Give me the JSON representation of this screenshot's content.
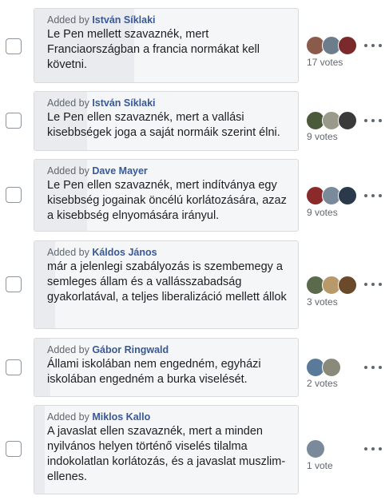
{
  "added_by_prefix": "Added by",
  "options": [
    {
      "author": "István Síklaki",
      "text": "Le Pen mellett szavaznék, mert Franciaországban a francia normákat kell követni.",
      "votes": "17 votes",
      "vote_share": 0.38,
      "avatar_colors": [
        "#8a5a4a",
        "#6d7d8c",
        "#7a2a2a"
      ]
    },
    {
      "author": "István Síklaki",
      "text": "Le Pen ellen szavaznék, mert a vallási kisebbségek joga a saját normáik szerint élni.",
      "votes": "9 votes",
      "vote_share": 0.2,
      "avatar_colors": [
        "#4a5a3a",
        "#9a9a8a",
        "#3a3a3a"
      ]
    },
    {
      "author": "Dave Mayer",
      "text": "Le Pen ellen szavaznék, mert indítványa egy kisebbség jogainak öncélú korlátozására, azaz a kisebbség elnyomására irányul.",
      "votes": "9 votes",
      "vote_share": 0.2,
      "avatar_colors": [
        "#8a2a2a",
        "#7a8a9a",
        "#2a3a4a"
      ]
    },
    {
      "author": "Káldos János",
      "text": "már a jelenlegi szabályozás is szembemegy a semleges állam és a vallásszabadság gyakorlatával, a teljes liberalizáció mellett állok",
      "votes": "3 votes",
      "vote_share": 0.07,
      "avatar_colors": [
        "#5a6a4a",
        "#b89a6a",
        "#6a4a2a"
      ]
    },
    {
      "author": "Gábor Ringwald",
      "text": "Állami iskolában nem engedném, egyházi iskolában engedném a burka viselését.",
      "votes": "2 votes",
      "vote_share": 0.05,
      "avatar_colors": [
        "#5a7a9a",
        "#8a8a7a"
      ]
    },
    {
      "author": "Miklos Kallo",
      "text": "A javaslat ellen szavaznék, mert a minden nyilvános helyen történő viselés tilalma indokolatlan korlátozás, és a javaslat muszlim-ellenes.",
      "votes": "1 vote",
      "vote_share": 0.02,
      "avatar_colors": [
        "#7a8a9a"
      ]
    }
  ]
}
